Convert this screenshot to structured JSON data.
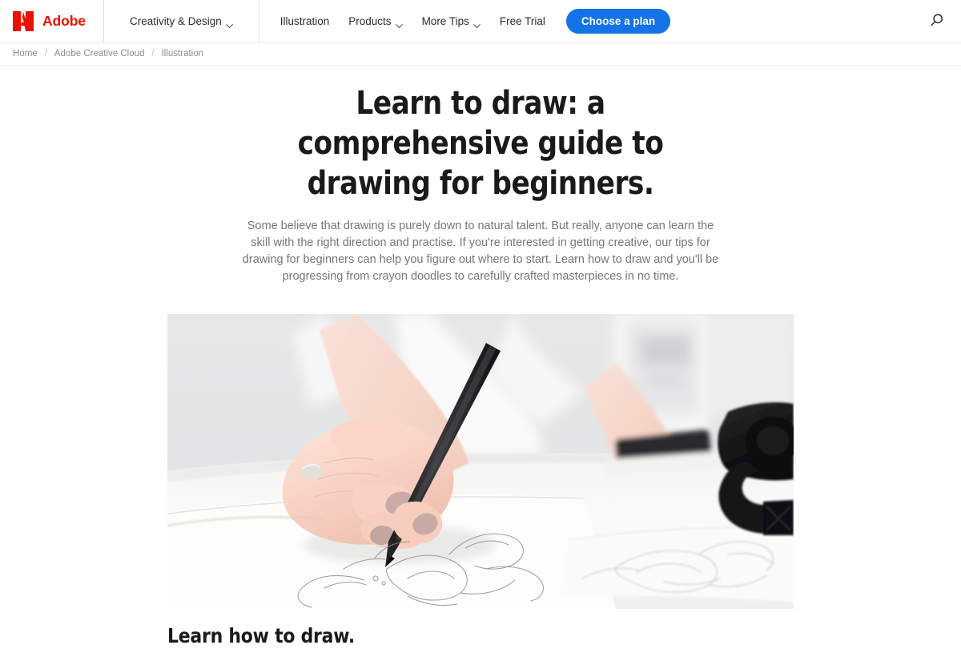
{
  "header": {
    "brand": {
      "name": "Adobe",
      "logo_icon": "adobe-a-logo",
      "color": "#EB1000"
    },
    "primary_nav": [
      {
        "label": "Creativity & Design",
        "has_dropdown": true,
        "icon": "chevron-down-icon"
      }
    ],
    "secondary_nav": [
      {
        "label": "Illustration",
        "has_dropdown": false
      },
      {
        "label": "Products",
        "has_dropdown": true,
        "icon": "chevron-down-icon"
      },
      {
        "label": "More Tips",
        "has_dropdown": true,
        "icon": "chevron-down-icon"
      },
      {
        "label": "Free Trial",
        "has_dropdown": false
      }
    ],
    "cta": {
      "label": "Choose a plan",
      "color": "#1473E6"
    },
    "search": {
      "icon": "search-icon",
      "label": "Search"
    }
  },
  "breadcrumb": {
    "separator": "/",
    "items": [
      {
        "label": "Home"
      },
      {
        "label": "Adobe Creative Cloud"
      },
      {
        "label": "Illustration"
      }
    ]
  },
  "article": {
    "title": "Learn to draw: a comprehensive guide to drawing for beginners.",
    "description": "Some believe that drawing is purely down to natural talent. But really, anyone can learn the skill with the right direction and practise. If you're interested in getting creative, our tips for drawing for beginners can help you figure out where to start. Learn how to draw and you'll be progressing from crayon doodles to carefully crafted masterpieces in no time.",
    "hero_image": {
      "name": "hand-drawing-with-pencil-photo",
      "alt": "A hand holding a black pencil sketching a floral drawing on white paper, with a camera and second sketch blurred in the background."
    },
    "next_section_heading": "Learn how to draw."
  }
}
